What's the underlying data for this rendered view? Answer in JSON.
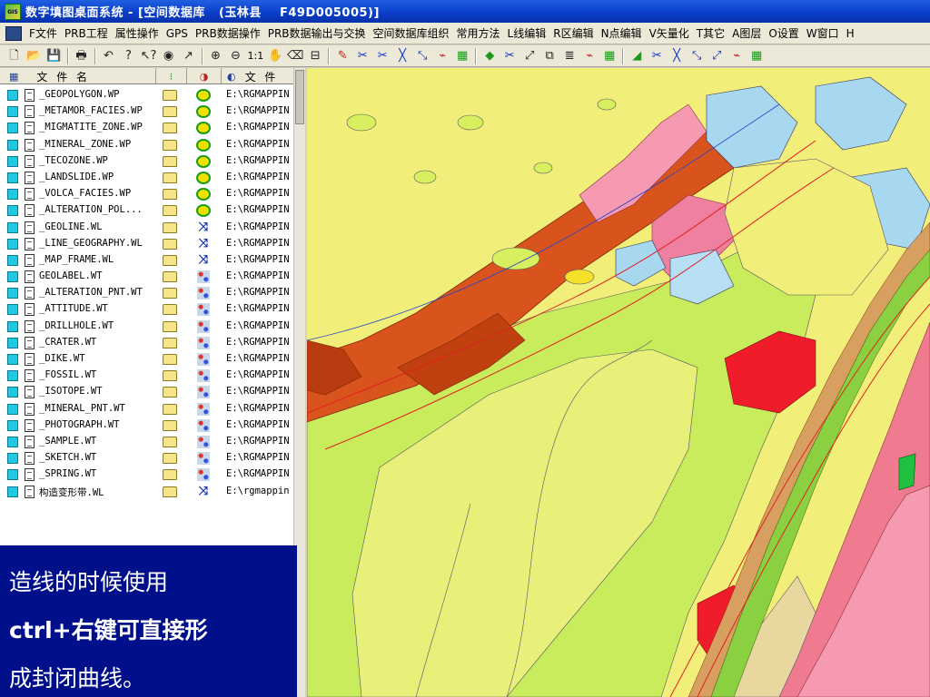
{
  "window": {
    "title": "数字填图桌面系统 - [空间数据库   (玉林县    F49D005005)]",
    "app_icon_text": "GIS"
  },
  "menu": {
    "items": [
      "F文件",
      "PRB工程",
      "属性操作",
      "GPS",
      "PRB数据操作",
      "PRB数据输出与交换",
      "空间数据库组织",
      "常用方法",
      "L线编辑",
      "R区编辑",
      "N点编辑",
      "V矢量化",
      "T其它",
      "A图层",
      "O设置",
      "W窗口",
      "H"
    ]
  },
  "toolbar": {
    "scale_label": "1:1"
  },
  "file_list": {
    "header_name": "文 件 名",
    "header_path": "文 件",
    "rows": [
      {
        "name": "_GEOPOLYGON.WP",
        "type": "poly",
        "path": "E:\\RGMAPPIN"
      },
      {
        "name": "_METAMOR_FACIES.WP",
        "type": "poly",
        "path": "E:\\RGMAPPIN"
      },
      {
        "name": "_MIGMATITE_ZONE.WP",
        "type": "poly",
        "path": "E:\\RGMAPPIN"
      },
      {
        "name": "_MINERAL_ZONE.WP",
        "type": "poly",
        "path": "E:\\RGMAPPIN"
      },
      {
        "name": "_TECOZONE.WP",
        "type": "poly",
        "path": "E:\\RGMAPPIN"
      },
      {
        "name": "_LANDSLIDE.WP",
        "type": "poly",
        "path": "E:\\RGMAPPIN"
      },
      {
        "name": "_VOLCA_FACIES.WP",
        "type": "poly",
        "path": "E:\\RGMAPPIN"
      },
      {
        "name": "_ALTERATION_POL...",
        "type": "poly",
        "path": "E:\\RGMAPPIN"
      },
      {
        "name": "_GEOLINE.WL",
        "type": "line",
        "path": "E:\\RGMAPPIN"
      },
      {
        "name": "_LINE_GEOGRAPHY.WL",
        "type": "line",
        "path": "E:\\RGMAPPIN"
      },
      {
        "name": "_MAP_FRAME.WL",
        "type": "line",
        "path": "E:\\RGMAPPIN"
      },
      {
        "name": "GEOLABEL.WT",
        "type": "point",
        "path": "E:\\RGMAPPIN"
      },
      {
        "name": "_ALTERATION_PNT.WT",
        "type": "point",
        "path": "E:\\RGMAPPIN"
      },
      {
        "name": "_ATTITUDE.WT",
        "type": "point",
        "path": "E:\\RGMAPPIN"
      },
      {
        "name": "_DRILLHOLE.WT",
        "type": "point",
        "path": "E:\\RGMAPPIN"
      },
      {
        "name": "_CRATER.WT",
        "type": "point",
        "path": "E:\\RGMAPPIN"
      },
      {
        "name": "_DIKE.WT",
        "type": "point",
        "path": "E:\\RGMAPPIN"
      },
      {
        "name": "_FOSSIL.WT",
        "type": "point",
        "path": "E:\\RGMAPPIN"
      },
      {
        "name": "_ISOTOPE.WT",
        "type": "point",
        "path": "E:\\RGMAPPIN"
      },
      {
        "name": "_MINERAL_PNT.WT",
        "type": "point",
        "path": "E:\\RGMAPPIN"
      },
      {
        "name": "_PHOTOGRAPH.WT",
        "type": "point",
        "path": "E:\\RGMAPPIN"
      },
      {
        "name": "_SAMPLE.WT",
        "type": "point",
        "path": "E:\\RGMAPPIN"
      },
      {
        "name": "_SKETCH.WT",
        "type": "point",
        "path": "E:\\RGMAPPIN"
      },
      {
        "name": "_SPRING.WT",
        "type": "point",
        "path": "E:\\RGMAPPIN"
      },
      {
        "name": "构造变形带.WL",
        "type": "line",
        "path": "E:\\rgmappin"
      }
    ]
  },
  "note": {
    "lines": [
      "造线的时候使用",
      "ctrl+右键可直接形",
      "成封闭曲线。"
    ]
  },
  "colors": {
    "title_bar": "#0a3cc8",
    "menu_bg": "#ece9d8",
    "note_bg": "#000f8a",
    "map_yellow": "#f0ee78",
    "map_orange": "#d8541c",
    "map_pink": "#f07a90",
    "map_red": "#f01c2c",
    "map_green": "#c8ec5c",
    "map_lightblue": "#a8d8f0"
  }
}
